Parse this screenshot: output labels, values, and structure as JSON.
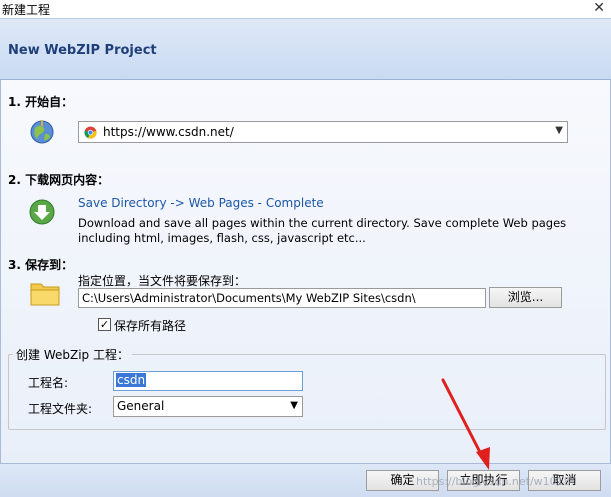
{
  "window": {
    "title": "新建工程",
    "close_glyph": "✕"
  },
  "header": {
    "title": "New WebZIP Project"
  },
  "step1": {
    "label": "1. 开始自：",
    "url": "https://www.csdn.net/"
  },
  "step2": {
    "label": "2. 下载网页内容：",
    "link": "Save Directory -> Web Pages - Complete",
    "description": "Download and save all pages within the current directory. Save complete Web pages including html, images, flash, css, javascript etc..."
  },
  "step3": {
    "label": "3. 保存到：",
    "location_label": "指定位置，当文件将要保存到：",
    "path": "C:\\Users\\Administrator\\Documents\\My WebZIP Sites\\csdn\\",
    "browse_label": "浏览...",
    "save_all_paths_label": "保存所有路径",
    "save_all_paths_checked": true
  },
  "project": {
    "group_title": "创建 WebZip 工程：",
    "name_label": "工程名:",
    "name_value": "csdn",
    "folder_label": "工程文件夹:",
    "folder_value": "General"
  },
  "footer": {
    "ok_label": "确定",
    "run_label": "立即执行",
    "cancel_label": "取消",
    "watermark": "https://blog.csdn.net/w1018"
  },
  "colors": {
    "header_title": "#1f3f7a",
    "link": "#1c56a8",
    "arrow": "#e0201c"
  }
}
